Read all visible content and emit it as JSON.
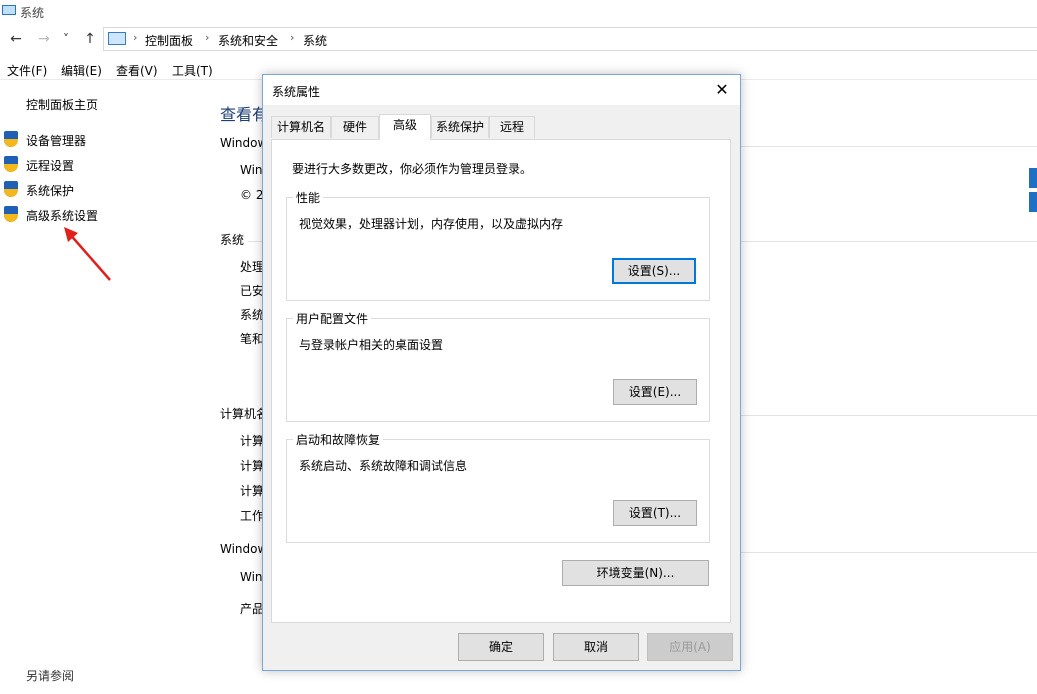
{
  "window": {
    "title": "系统"
  },
  "nav": {
    "back": "←",
    "forward": "→",
    "dropdown": "˅",
    "up": "↑",
    "breadcrumb": [
      "控制面板",
      "系统和安全",
      "系统"
    ],
    "sep": "›"
  },
  "menu": [
    "文件(F)",
    "编辑(E)",
    "查看(V)",
    "工具(T)"
  ],
  "left_panel": {
    "home": "控制面板主页",
    "links": [
      "设备管理器",
      "远程设置",
      "系统保护",
      "高级系统设置"
    ],
    "see_also": "另请参阅"
  },
  "background": {
    "heading": "查看有",
    "windows_section": "Window",
    "win_line": "Win",
    "copyright": "© 2",
    "system_section": "系统",
    "system_rows": [
      "处理",
      "已安",
      "系统",
      "笔和"
    ],
    "computer_section": "计算机名",
    "computer_rows": [
      "计算",
      "计算",
      "计算",
      "工作"
    ],
    "activation_section": "Window",
    "activation_rows": [
      "Win",
      "产品"
    ]
  },
  "dialog": {
    "title": "系统属性",
    "close": "✕",
    "tabs": [
      "计算机名",
      "硬件",
      "高级",
      "系统保护",
      "远程"
    ],
    "active_tab": "高级",
    "admin_note": "要进行大多数更改，你必须作为管理员登录。",
    "performance": {
      "label": "性能",
      "desc": "视觉效果，处理器计划，内存使用，以及虚拟内存",
      "button": "设置(S)..."
    },
    "profiles": {
      "label": "用户配置文件",
      "desc": "与登录帐户相关的桌面设置",
      "button": "设置(E)..."
    },
    "startup": {
      "label": "启动和故障恢复",
      "desc": "系统启动、系统故障和调试信息",
      "button": "设置(T)..."
    },
    "env_button": "环境变量(N)...",
    "ok": "确定",
    "cancel": "取消",
    "apply": "应用(A)"
  },
  "colors": {
    "accent": "#0078d7",
    "arrow": "#e0201b",
    "shield_blue": "#1f5fb5",
    "shield_yellow": "#f2b81c"
  }
}
